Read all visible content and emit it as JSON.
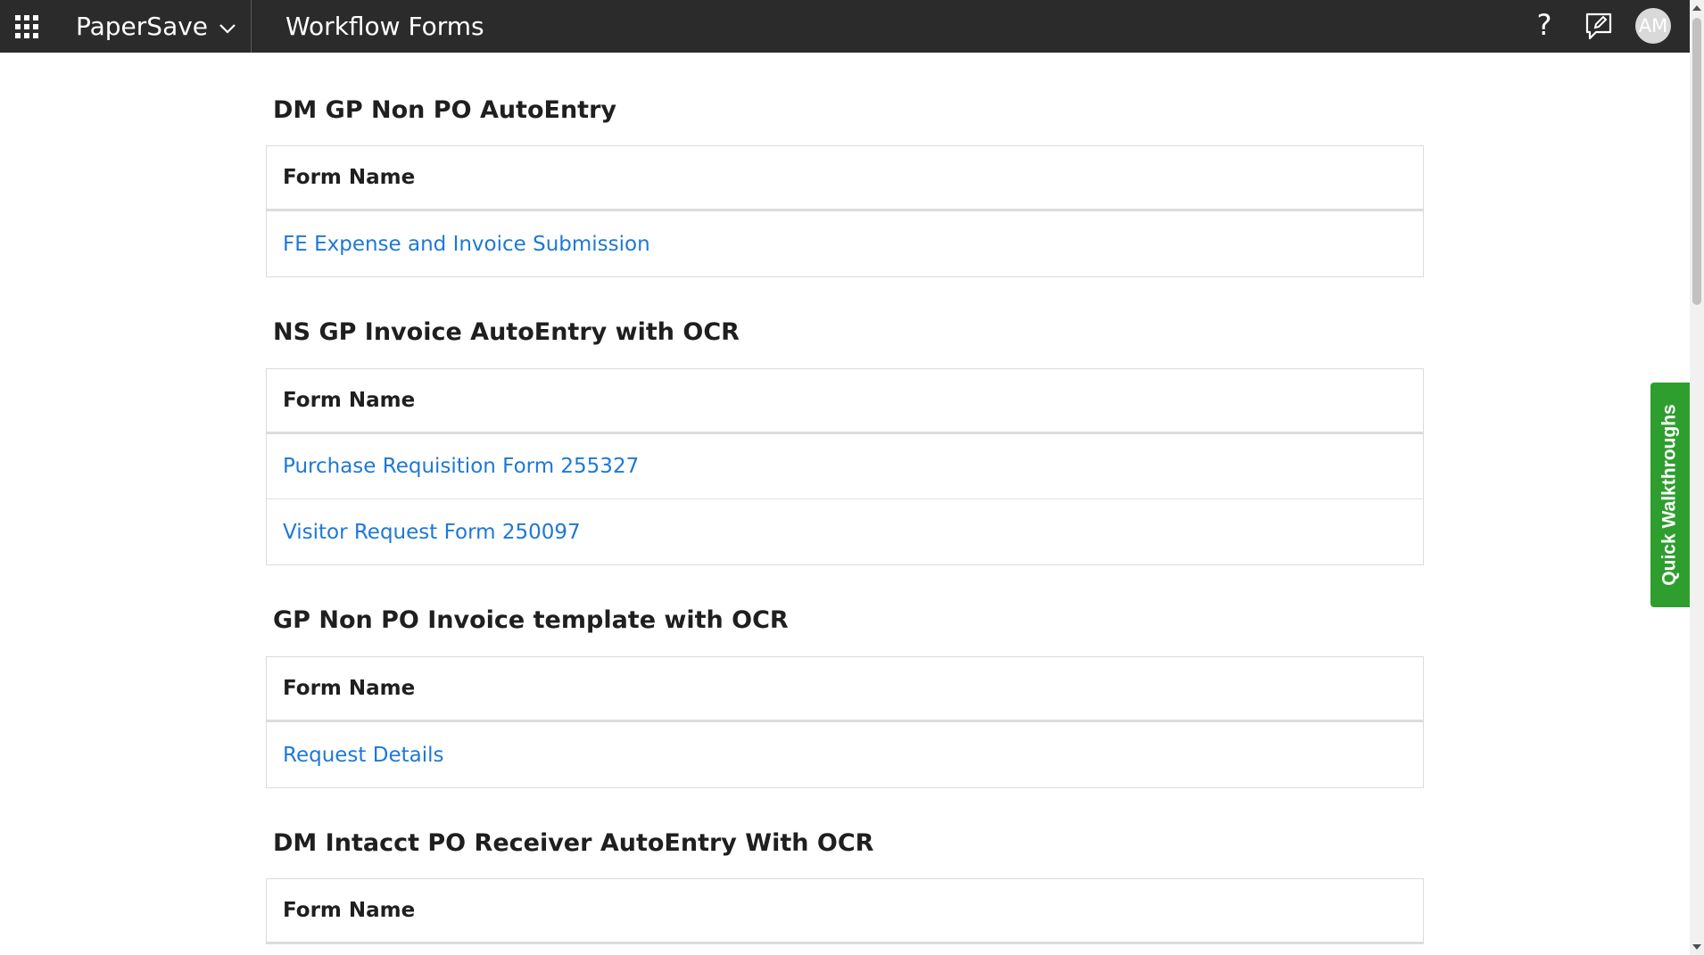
{
  "header": {
    "brand": "PaperSave",
    "app_title": "Workflow Forms",
    "help_glyph": "?",
    "avatar_initials": "AM",
    "icons": [
      "apps-grid-icon",
      "chevron-down-icon",
      "help-icon",
      "feedback-icon",
      "avatar"
    ]
  },
  "quick_walkthroughs_label": "Quick Walkthroughs",
  "colors": {
    "topbar": "#2b2b2b",
    "link": "#1e78d6",
    "qw_tab": "#2e9e2e"
  },
  "sections": [
    {
      "title": "DM GP Non PO AutoEntry",
      "header": "Form Name",
      "forms": [
        "FE Expense and Invoice Submission"
      ]
    },
    {
      "title": "NS GP Invoice AutoEntry with OCR",
      "header": "Form Name",
      "forms": [
        "Purchase Requisition Form 255327",
        "Visitor Request Form 250097"
      ]
    },
    {
      "title": "GP Non PO Invoice template with OCR",
      "header": "Form Name",
      "forms": [
        "Request Details"
      ]
    },
    {
      "title": "DM Intacct PO Receiver AutoEntry With OCR",
      "header": "Form Name",
      "forms": []
    }
  ]
}
